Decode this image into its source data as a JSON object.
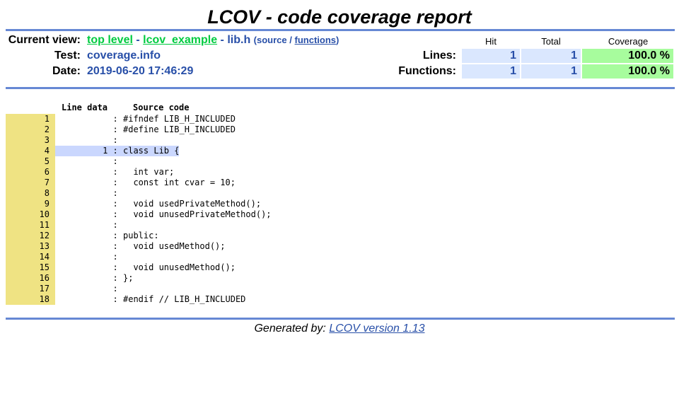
{
  "title": "LCOV - code coverage report",
  "header": {
    "current_view_label": "Current view:",
    "breadcrumb": {
      "top": "top level",
      "sep1": "-",
      "dir": "lcov_example",
      "sep2": "-",
      "file": "lib.h"
    },
    "view_links": {
      "open": "(",
      "source": "source",
      "slash": "/",
      "functions": "functions",
      "close": ")"
    },
    "test_label": "Test:",
    "test_value": "coverage.info",
    "date_label": "Date:",
    "date_value": "2019-06-20 17:46:29",
    "columns": {
      "hit": "Hit",
      "total": "Total",
      "coverage": "Coverage"
    },
    "lines": {
      "label": "Lines:",
      "hit": "1",
      "total": "1",
      "coverage": "100.0 %"
    },
    "functions": {
      "label": "Functions:",
      "hit": "1",
      "total": "1",
      "coverage": "100.0 %"
    }
  },
  "source": {
    "col_line_data": "Line data",
    "col_source": "Source code",
    "lines": [
      {
        "num": "1",
        "data": "",
        "code": "#ifndef LIB_H_INCLUDED"
      },
      {
        "num": "2",
        "data": "",
        "code": "#define LIB_H_INCLUDED"
      },
      {
        "num": "3",
        "data": "",
        "code": ""
      },
      {
        "num": "4",
        "data": "1",
        "code": "class Lib {"
      },
      {
        "num": "5",
        "data": "",
        "code": ""
      },
      {
        "num": "6",
        "data": "",
        "code": "  int var;"
      },
      {
        "num": "7",
        "data": "",
        "code": "  const int cvar = 10;"
      },
      {
        "num": "8",
        "data": "",
        "code": ""
      },
      {
        "num": "9",
        "data": "",
        "code": "  void usedPrivateMethod();"
      },
      {
        "num": "10",
        "data": "",
        "code": "  void unusedPrivateMethod();"
      },
      {
        "num": "11",
        "data": "",
        "code": ""
      },
      {
        "num": "12",
        "data": "",
        "code": "public:"
      },
      {
        "num": "13",
        "data": "",
        "code": "  void usedMethod();"
      },
      {
        "num": "14",
        "data": "",
        "code": ""
      },
      {
        "num": "15",
        "data": "",
        "code": "  void unusedMethod();"
      },
      {
        "num": "16",
        "data": "",
        "code": "};"
      },
      {
        "num": "17",
        "data": "",
        "code": ""
      },
      {
        "num": "18",
        "data": "",
        "code": "#endif // LIB_H_INCLUDED"
      }
    ]
  },
  "footer": {
    "label": "Generated by:",
    "link": "LCOV version 1.13"
  }
}
